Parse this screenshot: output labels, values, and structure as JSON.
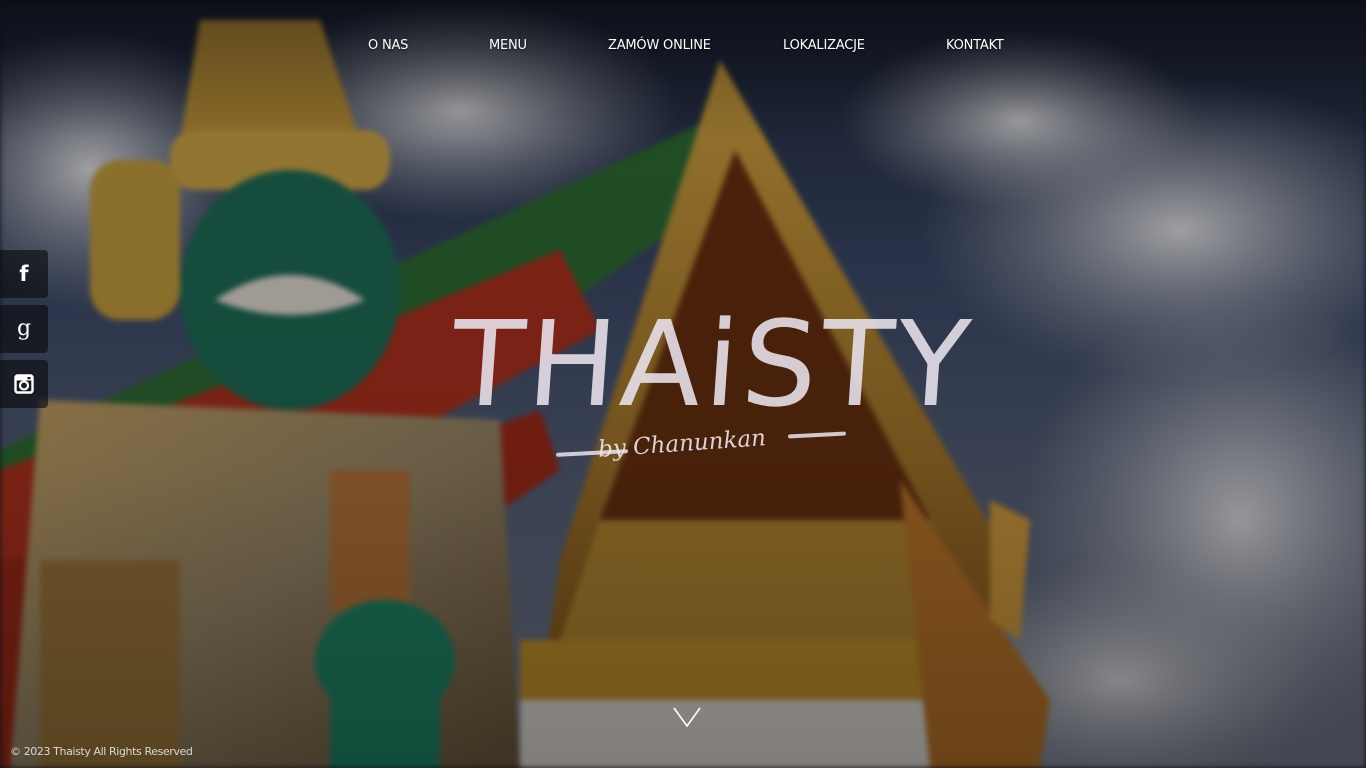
{
  "nav": {
    "items": [
      {
        "label": "O NAS"
      },
      {
        "label": "MENU"
      },
      {
        "label": "ZAMÓW ONLINE"
      },
      {
        "label": "LOKALIZACJE"
      },
      {
        "label": "KONTAKT"
      }
    ]
  },
  "social": {
    "items": [
      {
        "icon": "facebook-icon",
        "glyph": "f"
      },
      {
        "icon": "google-plus-icon",
        "glyph": "g"
      },
      {
        "icon": "instagram-icon",
        "glyph": ""
      }
    ]
  },
  "logo": {
    "word": "THAiSTY",
    "sub": "by Chanunkan"
  },
  "footer": {
    "copyright": "© 2023 Thaisty All Rights Reserved"
  },
  "colors": {
    "text": "#ffffff",
    "overlay": "#000000",
    "sky": "#3a4560",
    "temple_gold": "#c9962e",
    "temple_red": "#b5301e",
    "temple_green": "#2a7a3a",
    "guardian_jade": "#1f7a5e"
  }
}
